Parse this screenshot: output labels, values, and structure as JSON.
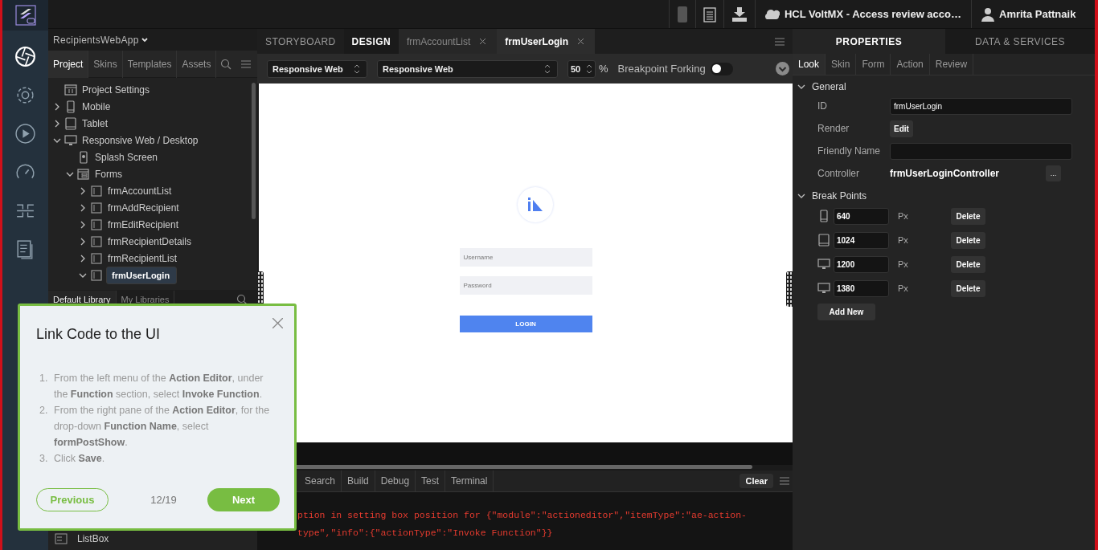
{
  "top_bar": {
    "project_title": "HCL VoltMX - Access review acco…",
    "user_name": "Amrita Pattnaik"
  },
  "left_panel": {
    "app_selector": "RecipientsWebApp",
    "tabs": [
      {
        "label": "Project",
        "selected": true
      },
      {
        "label": "Skins",
        "selected": false
      },
      {
        "label": "Templates",
        "selected": false
      },
      {
        "label": "Assets",
        "selected": false
      }
    ],
    "project_tree": [
      {
        "label": "Project Settings",
        "kind": "settings",
        "selected": false
      },
      {
        "label": "Mobile",
        "kind": "phone",
        "expanded": false,
        "selected": false
      },
      {
        "label": "Tablet",
        "kind": "tablet",
        "expanded": false,
        "selected": false
      },
      {
        "label": "Responsive Web / Desktop",
        "kind": "desktop",
        "expanded": true,
        "selected": false,
        "children": [
          {
            "label": "Splash Screen",
            "kind": "splash",
            "selected": false
          },
          {
            "label": "Forms",
            "kind": "forms",
            "expanded": true,
            "selected": false,
            "children": [
              {
                "label": "frmAccountList",
                "kind": "form",
                "expanded": false,
                "selected": false
              },
              {
                "label": "frmAddRecipient",
                "kind": "form",
                "expanded": false,
                "selected": false
              },
              {
                "label": "frmEditRecipient",
                "kind": "form",
                "expanded": false,
                "selected": false
              },
              {
                "label": "frmRecipientDetails",
                "kind": "form",
                "expanded": false,
                "selected": false
              },
              {
                "label": "frmRecipientList",
                "kind": "form",
                "expanded": false,
                "selected": false
              },
              {
                "label": "frmUserLogin",
                "kind": "form",
                "expanded": true,
                "selected": true
              }
            ]
          }
        ]
      }
    ],
    "library_tabs": [
      {
        "label": "Default Library",
        "selected": true
      },
      {
        "label": "My Libraries",
        "selected": false
      }
    ],
    "library_items": [
      {
        "label": "ListBox"
      }
    ]
  },
  "center": {
    "mode_tabs": [
      {
        "label": "STORYBOARD",
        "selected": false
      },
      {
        "label": "DESIGN",
        "selected": true
      }
    ],
    "form_tabs": [
      {
        "label": "frmAccountList",
        "selected": false
      },
      {
        "label": "frmUserLogin",
        "selected": true
      }
    ],
    "toolbar": {
      "channel": "Responsive Web",
      "platform": "Responsive Web",
      "zoom": "50",
      "zoom_unit": "%",
      "breakpoint_forking": {
        "label": "Breakpoint Forking",
        "on": false
      }
    },
    "preview": {
      "username_placeholder": "Username",
      "password_placeholder": "Password",
      "login_button": "LOGIN"
    },
    "console": {
      "tabs": [
        "Search",
        "Build",
        "Debug",
        "Test",
        "Terminal"
      ],
      "clear_button": "Clear",
      "log_lines": [
        "ption in setting box position for {\"module\":\"actioneditor\",\"itemType\":\"ae-action-",
        "type\",\"info\":{\"actionType\":\"Invoke Function\"}}"
      ]
    }
  },
  "right_panel": {
    "tabs": [
      {
        "label": "PROPERTIES",
        "selected": true
      },
      {
        "label": "DATA & SERVICES",
        "selected": false
      }
    ],
    "property_tabs": [
      {
        "label": "Look",
        "selected": true
      },
      {
        "label": "Skin",
        "selected": false
      },
      {
        "label": "Form",
        "selected": false
      },
      {
        "label": "Action",
        "selected": false
      },
      {
        "label": "Review",
        "selected": false
      }
    ],
    "general": {
      "heading": "General",
      "expanded": true,
      "fields": [
        {
          "label": "ID",
          "kind": "input",
          "value": "frmUserLogin"
        },
        {
          "label": "Render",
          "kind": "button",
          "value": "Edit"
        },
        {
          "label": "Friendly Name",
          "kind": "input"
        },
        {
          "label": "Controller",
          "kind": "text",
          "value": "frmUserLoginController",
          "action": "..."
        }
      ]
    },
    "break_points": {
      "heading": "Break Points",
      "expanded": true,
      "rows": [
        {
          "kind": "phone",
          "value": "640",
          "unit": "Px",
          "delete": "Delete"
        },
        {
          "kind": "tablet",
          "value": "1024",
          "unit": "Px",
          "delete": "Delete"
        },
        {
          "kind": "desktop",
          "value": "1200",
          "unit": "Px",
          "delete": "Delete"
        },
        {
          "kind": "desktop",
          "value": "1380",
          "unit": "Px",
          "delete": "Delete"
        }
      ],
      "add_button": "Add New"
    }
  },
  "tour": {
    "title": "Link Code to the UI",
    "steps": [
      {
        "number": "1.",
        "text": "From the left menu of the **Action Editor**, under the **Function** section, select **Invoke Function**."
      },
      {
        "number": "2.",
        "text": "From the right pane of the **Action Editor**, for the drop-down **Function Name**, select **formPostShow**."
      },
      {
        "number": "3.",
        "text": "Click **Save**."
      }
    ],
    "previous": "Previous",
    "counter": "12/19",
    "next": "Next"
  }
}
